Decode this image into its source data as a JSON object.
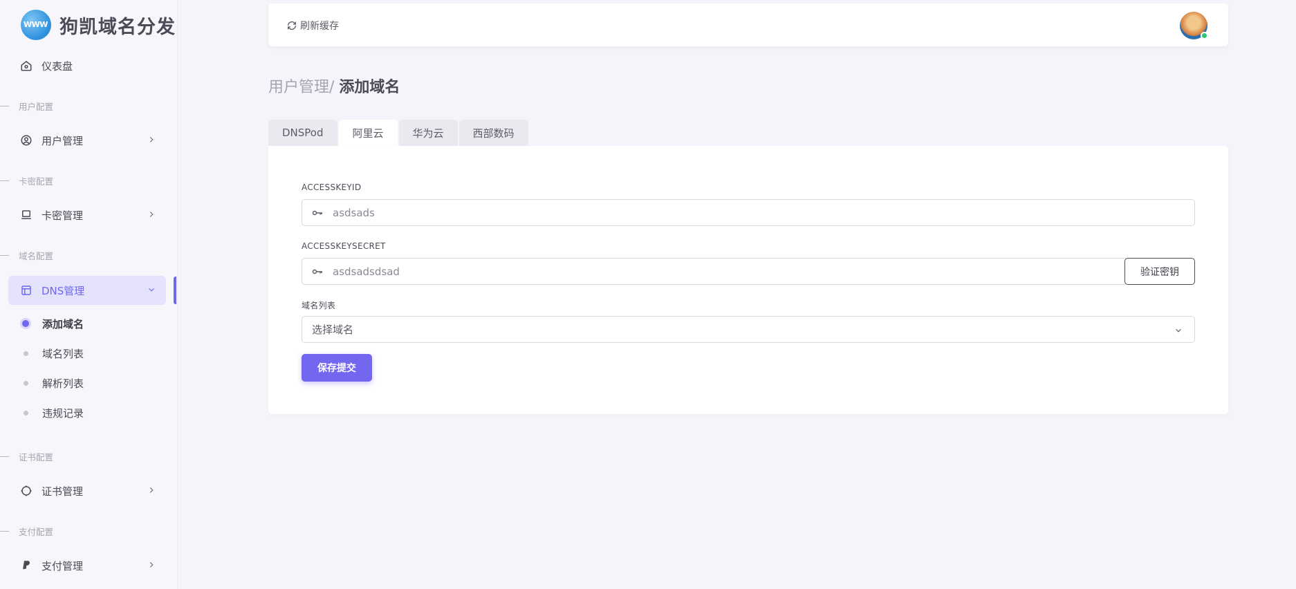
{
  "brand": {
    "title": "狗凯域名分发",
    "logo_text": "WWW"
  },
  "sidebar": {
    "dashboard": "仪表盘",
    "sections": {
      "user": "用户配置",
      "card": "卡密配置",
      "domain": "域名配置",
      "cert": "证书配置",
      "pay": "支付配置"
    },
    "items": {
      "user_mgmt": "用户管理",
      "card_mgmt": "卡密管理",
      "dns_mgmt": "DNS管理",
      "cert_mgmt": "证书管理",
      "pay_mgmt": "支付管理"
    },
    "dns_sub": [
      "添加域名",
      "域名列表",
      "解析列表",
      "违规记录"
    ]
  },
  "topbar": {
    "refresh": "刷新缓存"
  },
  "breadcrumb": {
    "parent": "用户管理/",
    "current": "添加域名"
  },
  "tabs": [
    "DNSPod",
    "阿里云",
    "华为云",
    "西部数码"
  ],
  "form": {
    "accesskeyid_label": "ACCESSKEYID",
    "accesskeyid_value": "asdsads",
    "accesskeysecret_label": "ACCESSKEYSECRET",
    "accesskeysecret_value": "asdsadsdsad",
    "verify_button": "验证密钥",
    "domain_list_label": "域名列表",
    "domain_select_placeholder": "选择域名",
    "submit_button": "保存提交"
  },
  "colors": {
    "accent": "#7367f0",
    "active_bg": "#e4e3fb",
    "online": "#28c76f"
  }
}
